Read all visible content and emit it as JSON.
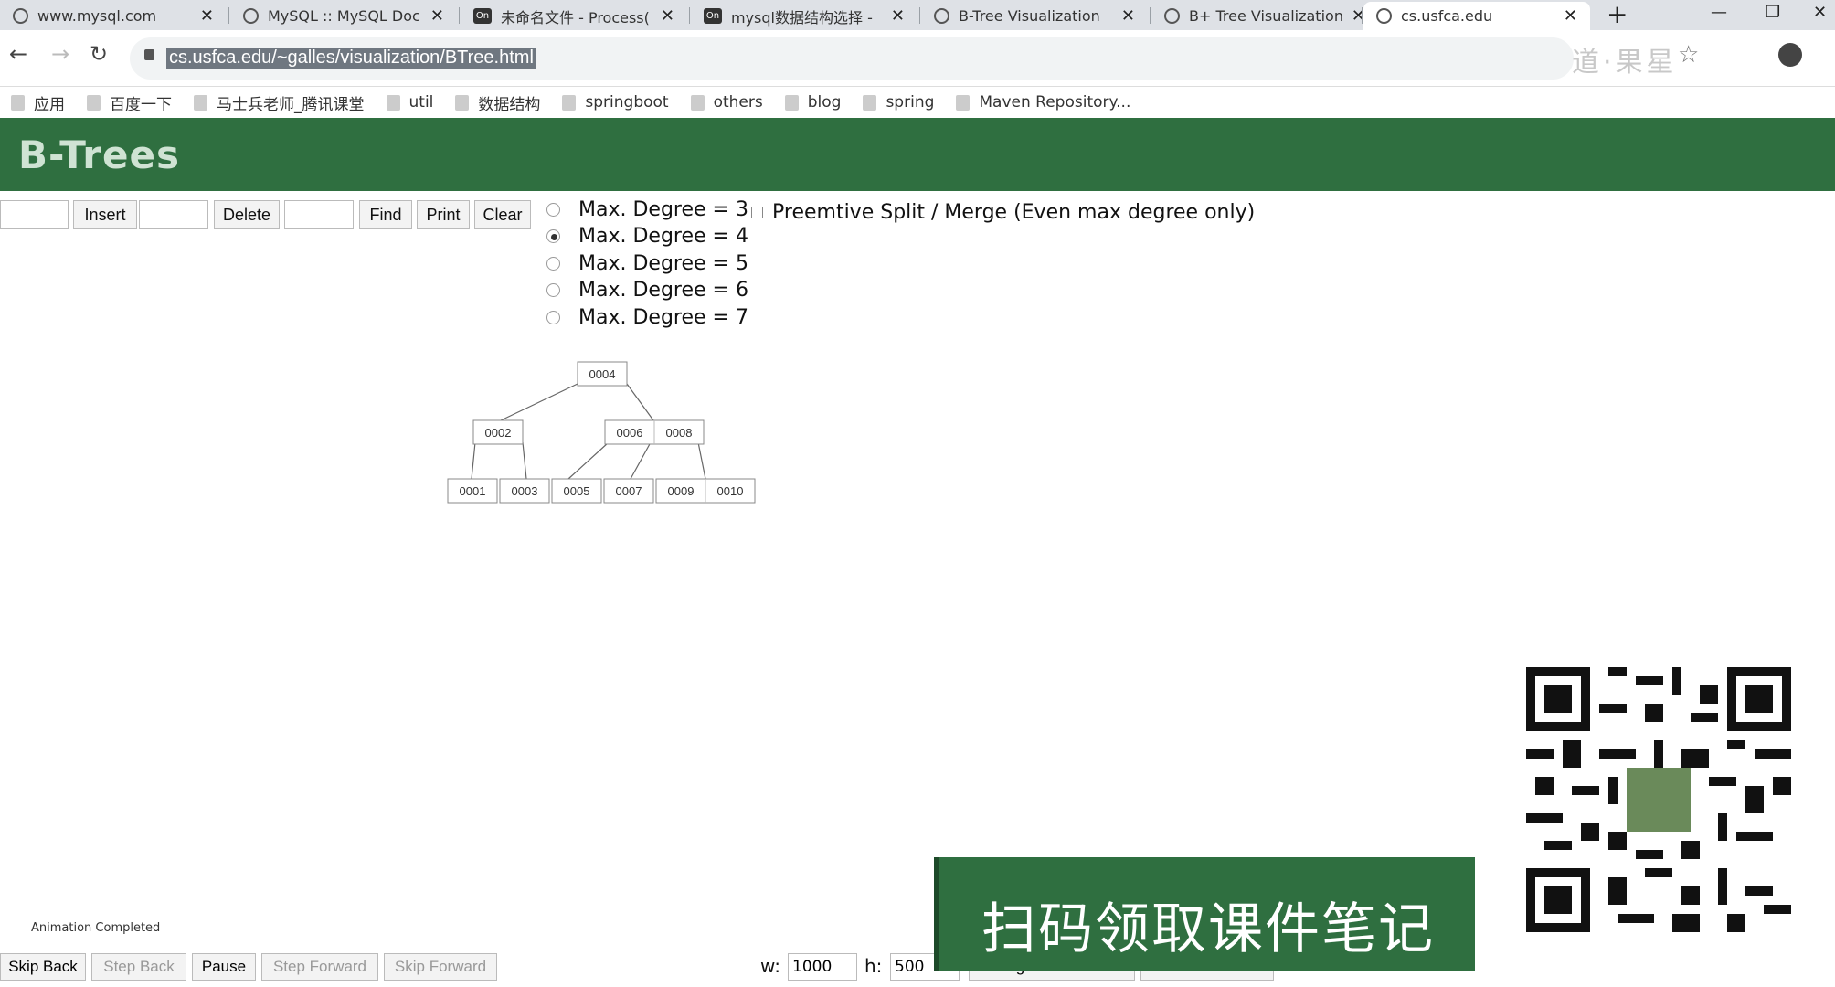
{
  "tabs": [
    {
      "label": "www.mysql.com",
      "icon": "globe-icon"
    },
    {
      "label": "MySQL :: MySQL Doc",
      "icon": "globe-icon"
    },
    {
      "label": "未命名文件 - Process(",
      "icon": "processon-icon"
    },
    {
      "label": "mysql数据结构选择 -",
      "icon": "processon-icon"
    },
    {
      "label": "B-Tree Visualization",
      "icon": "globe-icon"
    },
    {
      "label": "B+ Tree Visualization",
      "icon": "globe-icon"
    },
    {
      "label": "cs.usfca.edu",
      "icon": "globe-icon"
    }
  ],
  "tab_processon_glyph": "On",
  "new_tab_glyph": "+",
  "close_glyph": "✕",
  "window_controls": {
    "minimize": "—",
    "restore": "❐",
    "close": "✕"
  },
  "nav": {
    "back": "←",
    "forward": "→",
    "reload": "↻"
  },
  "address": {
    "url": "cs.usfca.edu/~galles/visualization/BTree.html"
  },
  "watermark": "道·果星",
  "bookmark_star": "☆",
  "bookmarks": [
    "应用",
    "百度一下",
    "马士兵老师_腾讯课堂",
    "util",
    "数据结构",
    "springboot",
    "others",
    "blog",
    "spring",
    "Maven Repository..."
  ],
  "page": {
    "title": "B-Trees"
  },
  "controls": {
    "insert_label": "Insert",
    "delete_label": "Delete",
    "find_label": "Find",
    "print_label": "Print",
    "clear_label": "Clear",
    "insert_value": "",
    "delete_value": "",
    "find_value": ""
  },
  "degree_options": [
    {
      "label": "Max. Degree = 3",
      "checked": false
    },
    {
      "label": "Max. Degree = 4",
      "checked": true
    },
    {
      "label": "Max. Degree = 5",
      "checked": false
    },
    {
      "label": "Max. Degree = 6",
      "checked": false
    },
    {
      "label": "Max. Degree = 7",
      "checked": false
    }
  ],
  "preemptive_label": "Preemtive Split / Merge (Even max degree only)",
  "tree": {
    "root": [
      "0004"
    ],
    "level1": [
      [
        "0002"
      ],
      [
        "0006",
        "0008"
      ]
    ],
    "leaves": [
      "0001",
      "0003",
      "0005",
      "0007",
      "0009",
      "0010"
    ]
  },
  "status": "Animation Completed",
  "bottom": {
    "skip_back": "Skip Back",
    "step_back": "Step Back",
    "pause": "Pause",
    "step_forward": "Step Forward",
    "skip_forward": "Skip Forward",
    "w_label": "w:",
    "w_value": "1000",
    "h_label": "h:",
    "h_value": "500",
    "change_canvas": "Change Canvas Size",
    "move_controls": "Move Controls"
  },
  "promo": {
    "text": "扫码领取课件笔记"
  },
  "colors": {
    "header_bg": "#2f6f40",
    "header_text": "#cfe3d3"
  }
}
